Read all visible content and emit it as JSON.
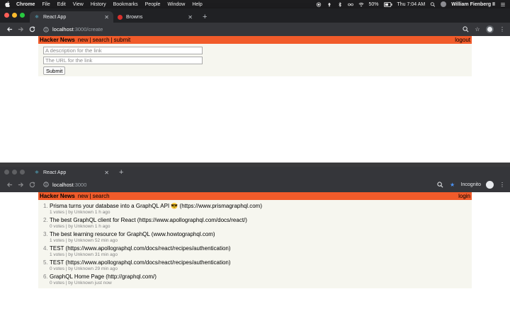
{
  "menubar": {
    "app_name": "Chrome",
    "items": [
      "File",
      "Edit",
      "View",
      "History",
      "Bookmarks",
      "People",
      "Window",
      "Help"
    ],
    "battery": "50%",
    "clock": "Thu 7:04 AM",
    "user": "William Fienberg II"
  },
  "window1": {
    "tabs": [
      {
        "title": "React App",
        "favicon": "react-icon"
      },
      {
        "title": "Browns",
        "favicon": "browns-icon"
      }
    ],
    "url_host": "localhost",
    "url_path": ":3000/create",
    "hn": {
      "brand": "Hacker News",
      "nav_new": "new",
      "nav_search": "search",
      "nav_submit": "submit",
      "sep": "|",
      "logout": "logout"
    },
    "form": {
      "description_placeholder": "A description for the link",
      "url_placeholder": "The URL for the link",
      "submit_label": "Submit"
    }
  },
  "window2": {
    "tabs": [
      {
        "title": "React App",
        "favicon": "react-icon"
      }
    ],
    "url_host": "localhost",
    "url_path": ":3000",
    "incognito_label": "Incognito",
    "hn": {
      "brand": "Hacker News",
      "nav_new": "new",
      "nav_search": "search",
      "sep": "|",
      "login": "login"
    },
    "links": [
      {
        "num": "1.",
        "description": "Prisma turns your database into a GraphQL API 😎 (https://www.prismagraphql.com)",
        "meta": "1 votes | by Unknown 1 h ago"
      },
      {
        "num": "2.",
        "description": "The best GraphQL client for React (https://www.apollographql.com/docs/react/)",
        "meta": "0 votes | by Unknown 1 h ago"
      },
      {
        "num": "3.",
        "description": "The best learning resource for GraphQL (www.howtographql.com)",
        "meta": "1 votes | by Unknown 52 min ago"
      },
      {
        "num": "4.",
        "description": "TEST (https://www.apollographql.com/docs/react/recipes/authentication)",
        "meta": "1 votes | by Unknown 31 min ago"
      },
      {
        "num": "5.",
        "description": "TEST (https://www.apollographql.com/docs/react/recipes/authentication)",
        "meta": "0 votes | by Unknown 29 min ago"
      },
      {
        "num": "6.",
        "description": "GraphQL Home Page (http://graphql.com/)",
        "meta": "0 votes | by Unknown just now"
      }
    ]
  },
  "colors": {
    "hn_header": "#f15b2a",
    "hn_background": "#f6f6ef",
    "chrome_dark": "#35363a",
    "star_blue": "#4b93f5"
  }
}
